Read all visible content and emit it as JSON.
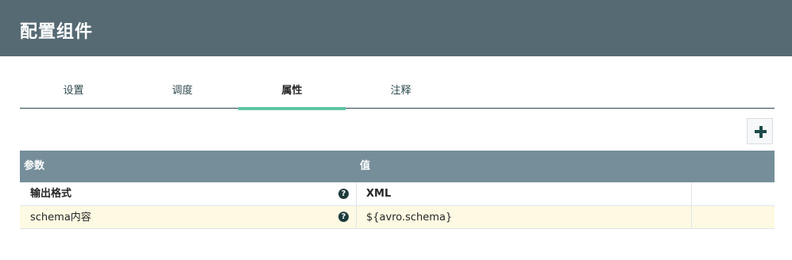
{
  "dialog": {
    "title": "配置组件"
  },
  "tabs": [
    {
      "label": "设置",
      "active": false
    },
    {
      "label": "调度",
      "active": false
    },
    {
      "label": "属性",
      "active": true
    },
    {
      "label": "注释",
      "active": false
    }
  ],
  "toolbar": {
    "add_icon": "plus-icon"
  },
  "table": {
    "columns": [
      "参数",
      "值"
    ],
    "rows": [
      {
        "name": "输出格式",
        "value": "XML",
        "help_icon": "question-circle-icon",
        "bold": true
      },
      {
        "name": "schema内容",
        "value": "${avro.schema}",
        "help_icon": "question-circle-icon",
        "bold": false
      }
    ]
  },
  "colors": {
    "header_bg": "#566a74",
    "table_header_bg": "#768e9a",
    "active_tab_accent": "#5fc6a4",
    "alt_row_bg": "#fdf9e2"
  }
}
